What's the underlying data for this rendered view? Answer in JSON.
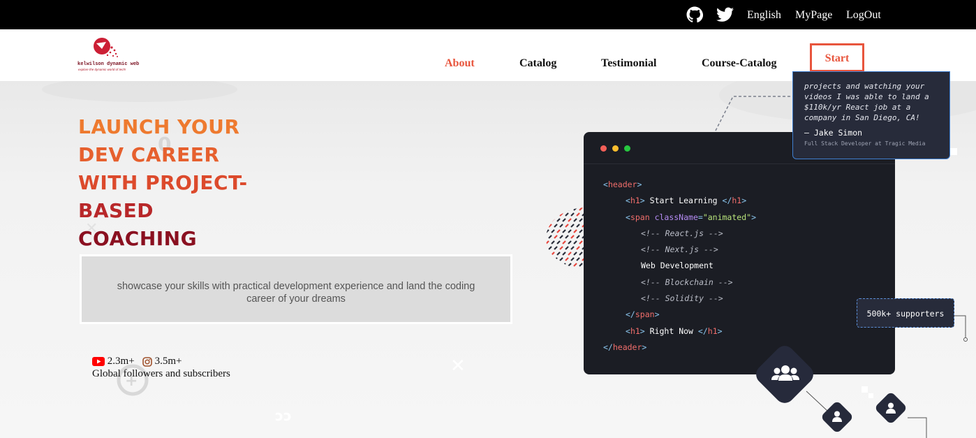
{
  "topbar": {
    "github_icon": "github-icon",
    "twitter_icon": "twitter-icon",
    "links": [
      "English",
      "MyPage",
      "LogOut"
    ]
  },
  "brand": {
    "name": "kelwilson dynamic web",
    "tagline": "explore the dynamic world of tech!"
  },
  "nav": {
    "items": [
      "About",
      "Catalog",
      "Testimonial",
      "Course-Catalog"
    ],
    "active": "About",
    "start_label": "Start"
  },
  "hero": {
    "headline_lines": [
      "LAUNCH YOUR",
      "DEV CAREER",
      "WITH PROJECT-",
      "BASED",
      "COACHING"
    ],
    "description": "showcase your skills with practical development experience and land the coding career of your dreams",
    "youtube_count": "2.3m+",
    "instagram_count": "3.5m+",
    "followers_caption": "Global followers and subscribers"
  },
  "code_card": {
    "window_dots": [
      "#f25f58",
      "#fbbe2e",
      "#27c840"
    ],
    "lines": [
      {
        "indent": 0,
        "parts": [
          [
            "br",
            "<"
          ],
          [
            "tag",
            "header"
          ],
          [
            "br",
            ">"
          ]
        ]
      },
      {
        "indent": 1,
        "parts": [
          [
            "br",
            "<"
          ],
          [
            "tag",
            "h1"
          ],
          [
            "br",
            "> "
          ],
          [
            "txt",
            "Start Learning "
          ],
          [
            "br",
            "</"
          ],
          [
            "tag",
            "h1"
          ],
          [
            "br",
            ">"
          ]
        ]
      },
      {
        "indent": 1,
        "parts": [
          [
            "br",
            "<"
          ],
          [
            "tag",
            "span "
          ],
          [
            "attr",
            "className"
          ],
          [
            "br",
            "="
          ],
          [
            "str",
            "\"animated\""
          ],
          [
            "br",
            ">"
          ]
        ]
      },
      {
        "indent": 2,
        "parts": [
          [
            "cmt",
            "<!-- React.js -->"
          ]
        ]
      },
      {
        "indent": 2,
        "parts": [
          [
            "cmt",
            "<!-- Next.js -->"
          ]
        ]
      },
      {
        "indent": 2,
        "parts": [
          [
            "txt",
            "Web Development"
          ]
        ]
      },
      {
        "indent": 2,
        "parts": [
          [
            "cmt",
            "<!-- Blockchain -->"
          ]
        ]
      },
      {
        "indent": 2,
        "parts": [
          [
            "cmt",
            "<!-- Solidity -->"
          ]
        ]
      },
      {
        "indent": 1,
        "parts": [
          [
            "br",
            "</"
          ],
          [
            "tag",
            "span"
          ],
          [
            "br",
            ">"
          ]
        ]
      },
      {
        "indent": 1,
        "parts": [
          [
            "br",
            "<"
          ],
          [
            "tag",
            "h1"
          ],
          [
            "br",
            "> "
          ],
          [
            "txt",
            "Right Now "
          ],
          [
            "br",
            "</"
          ],
          [
            "tag",
            "h1"
          ],
          [
            "br",
            ">"
          ]
        ]
      },
      {
        "indent": 0,
        "parts": [
          [
            "br",
            "</"
          ],
          [
            "tag",
            "header"
          ],
          [
            "br",
            ">"
          ]
        ]
      }
    ]
  },
  "testimonial": {
    "quote": "projects and watching your videos I was able to land a $110k/yr React job at a company in San Diego, CA!",
    "author": "— Jake Simon",
    "role": "Full Stack Developer at Tragic Media"
  },
  "supporters": {
    "label": "500k+ supporters"
  },
  "colors": {
    "accent": "#e8553d",
    "dark_card": "#1b1d24",
    "navy": "#272b3a"
  }
}
